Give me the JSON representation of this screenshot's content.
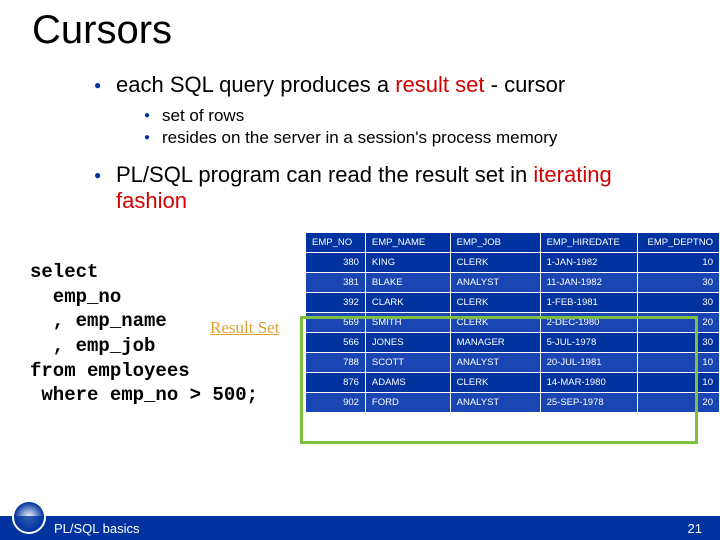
{
  "title": "Cursors",
  "b1_pre": "each SQL query produces a ",
  "b1_red": "result set",
  "b1_post": " - cursor",
  "b1a": "set of rows",
  "b1b": "resides on the server in a session's process memory",
  "b2_pre": "PL/SQL program can read the result set in ",
  "b2_red": "iterating fashion",
  "code_text": "select\n  emp_no\n  , emp_name\n  , emp_job\nfrom employees\n where emp_no > 500;",
  "result_label": "Result Set",
  "headers": [
    "EMP_NO",
    "EMP_NAME",
    "EMP_JOB",
    "EMP_HIREDATE",
    "EMP_DEPTNO"
  ],
  "chart_data": {
    "type": "table",
    "columns": [
      "EMP_NO",
      "EMP_NAME",
      "EMP_JOB",
      "EMP_HIREDATE",
      "EMP_DEPTNO"
    ],
    "rows": [
      [
        "380",
        "KING",
        "CLERK",
        "1-JAN-1982",
        "10"
      ],
      [
        "381",
        "BLAKE",
        "ANALYST",
        "11-JAN-1982",
        "30"
      ],
      [
        "392",
        "CLARK",
        "CLERK",
        "1-FEB-1981",
        "30"
      ],
      [
        "569",
        "SMITH",
        "CLERK",
        "2-DEC-1980",
        "20"
      ],
      [
        "566",
        "JONES",
        "MANAGER",
        "5-JUL-1978",
        "30"
      ],
      [
        "788",
        "SCOTT",
        "ANALYST",
        "20-JUL-1981",
        "10"
      ],
      [
        "876",
        "ADAMS",
        "CLERK",
        "14-MAR-1980",
        "10"
      ],
      [
        "902",
        "FORD",
        "ANALYST",
        "25-SEP-1978",
        "20"
      ]
    ]
  },
  "footer_text": "PL/SQL basics",
  "page_number": "21"
}
